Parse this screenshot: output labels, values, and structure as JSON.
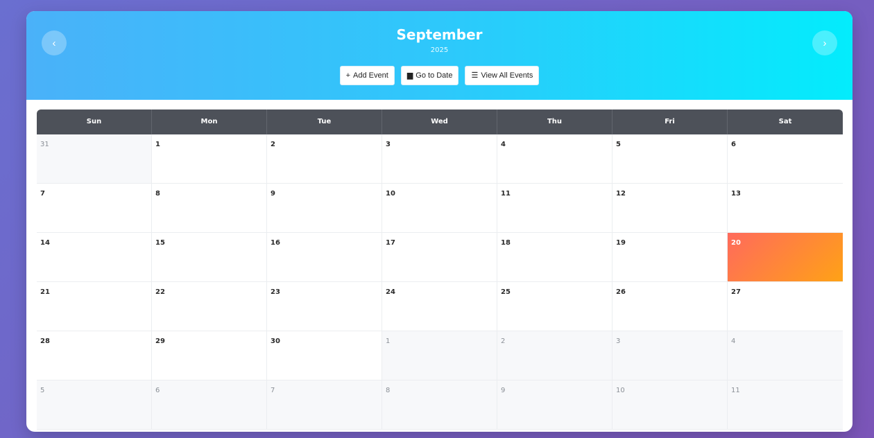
{
  "header": {
    "month": "September",
    "year": "2025",
    "prev_icon": "chevron-left-icon",
    "next_icon": "chevron-right-icon",
    "prev_glyph": "‹",
    "next_glyph": "›"
  },
  "actions": {
    "add_event": {
      "icon": "plus-icon",
      "glyph": "+",
      "label": "Add Event"
    },
    "go_to_date": {
      "icon": "calendar-icon",
      "glyph": "▆",
      "label": "Go to Date"
    },
    "view_all": {
      "icon": "list-icon",
      "glyph": "☰",
      "label": "View All Events"
    }
  },
  "weekdays": [
    "Sun",
    "Mon",
    "Tue",
    "Wed",
    "Thu",
    "Fri",
    "Sat"
  ],
  "days": [
    {
      "n": "31",
      "other": true
    },
    {
      "n": "1"
    },
    {
      "n": "2"
    },
    {
      "n": "3"
    },
    {
      "n": "4"
    },
    {
      "n": "5"
    },
    {
      "n": "6"
    },
    {
      "n": "7"
    },
    {
      "n": "8"
    },
    {
      "n": "9"
    },
    {
      "n": "10"
    },
    {
      "n": "11"
    },
    {
      "n": "12"
    },
    {
      "n": "13"
    },
    {
      "n": "14"
    },
    {
      "n": "15"
    },
    {
      "n": "16"
    },
    {
      "n": "17"
    },
    {
      "n": "18"
    },
    {
      "n": "19"
    },
    {
      "n": "20",
      "today": true
    },
    {
      "n": "21"
    },
    {
      "n": "22"
    },
    {
      "n": "23"
    },
    {
      "n": "24"
    },
    {
      "n": "25"
    },
    {
      "n": "26"
    },
    {
      "n": "27"
    },
    {
      "n": "28"
    },
    {
      "n": "29"
    },
    {
      "n": "30"
    },
    {
      "n": "1",
      "other": true
    },
    {
      "n": "2",
      "other": true
    },
    {
      "n": "3",
      "other": true
    },
    {
      "n": "4",
      "other": true
    },
    {
      "n": "5",
      "other": true
    },
    {
      "n": "6",
      "other": true
    },
    {
      "n": "7",
      "other": true
    },
    {
      "n": "8",
      "other": true
    },
    {
      "n": "9",
      "other": true
    },
    {
      "n": "10",
      "other": true
    },
    {
      "n": "11",
      "other": true
    }
  ],
  "colors": {
    "header_gradient_start": "#4ab1f9",
    "header_gradient_end": "#03ecfc",
    "weekday_bar": "#4d5159",
    "today_gradient_start": "#ff6a5c",
    "today_gradient_end": "#ffa216",
    "page_background": "#6a6fd0"
  }
}
